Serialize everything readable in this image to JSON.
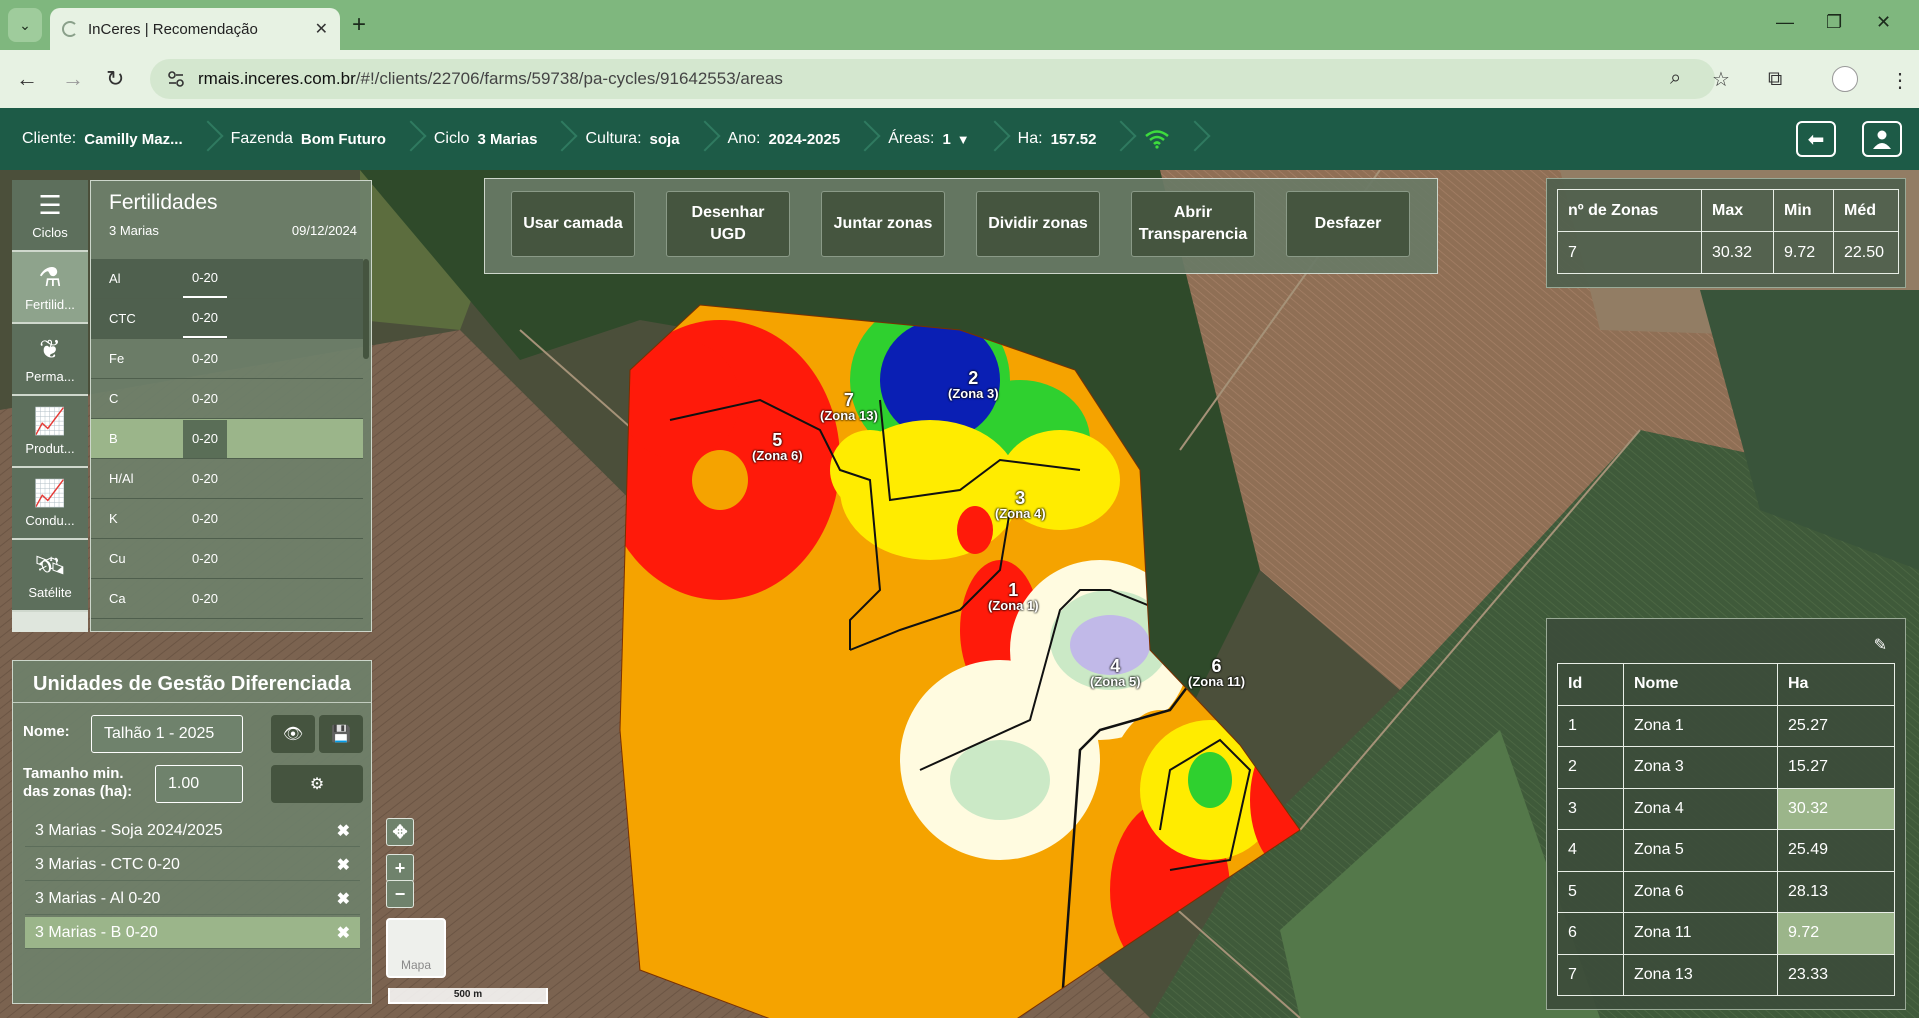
{
  "browser": {
    "tab_title": "InCeres | Recomendação",
    "url_host": "rmais.inceres.com.br",
    "url_path": "/#!/clients/22706/farms/59738/pa-cycles/91642553/areas"
  },
  "navbar": {
    "cliente_label": "Cliente:",
    "cliente_value": "Camilly Maz...",
    "fazenda_label": "Fazenda",
    "fazenda_value": "Bom Futuro",
    "ciclo_label": "Ciclo",
    "ciclo_value": "3 Marias",
    "cultura_label": "Cultura:",
    "cultura_value": "soja",
    "ano_label": "Ano:",
    "ano_value": "2024-2025",
    "areas_label": "Áreas:",
    "areas_value": "1",
    "ha_label": "Ha:",
    "ha_value": "157.52"
  },
  "rail": [
    {
      "label": "Ciclos",
      "icon": "list-icon"
    },
    {
      "label": "Fertilid...",
      "icon": "flask-icon"
    },
    {
      "label": "Perma...",
      "icon": "plant-icon"
    },
    {
      "label": "Produt...",
      "icon": "chart-icon"
    },
    {
      "label": "Condu...",
      "icon": "chart-icon"
    },
    {
      "label": "Satélite",
      "icon": "satellite-icon"
    }
  ],
  "fertilidades": {
    "title": "Fertilidades",
    "cycle": "3 Marias",
    "date": "09/12/2024",
    "rows": [
      {
        "name": "Al",
        "depth": "0-20"
      },
      {
        "name": "CTC",
        "depth": "0-20"
      },
      {
        "name": "Fe",
        "depth": "0-20"
      },
      {
        "name": "C",
        "depth": "0-20"
      },
      {
        "name": "B",
        "depth": "0-20"
      },
      {
        "name": "H/Al",
        "depth": "0-20"
      },
      {
        "name": "K",
        "depth": "0-20"
      },
      {
        "name": "Cu",
        "depth": "0-20"
      },
      {
        "name": "Ca",
        "depth": "0-20"
      }
    ]
  },
  "ugd": {
    "title": "Unidades de Gestão Diferenciada",
    "nome_label": "Nome:",
    "nome_value": "Talhão 1 - 2025",
    "tamanho_label_1": "Tamanho min.",
    "tamanho_label_2": "das zonas (ha):",
    "tamanho_value": "1.00",
    "layers": [
      "3 Marias - Soja 2024/2025",
      "3 Marias - CTC 0-20",
      "3 Marias - Al 0-20",
      "3 Marias - B 0-20"
    ]
  },
  "tools": {
    "usar_camada": "Usar camada",
    "desenhar_1": "Desenhar",
    "desenhar_2": "UGD",
    "juntar": "Juntar zonas",
    "dividir": "Dividir zonas",
    "abrir_1": "Abrir",
    "abrir_2": "Transparencia",
    "desfazer": "Desfazer"
  },
  "stats": {
    "headers": [
      "nº de Zonas",
      "Max",
      "Min",
      "Méd"
    ],
    "values": [
      "7",
      "30.32",
      "9.72",
      "22.50"
    ]
  },
  "zones": {
    "headers": [
      "Id",
      "Nome",
      "Ha"
    ],
    "rows": [
      {
        "id": "1",
        "name": "Zona 1",
        "ha": "25.27"
      },
      {
        "id": "2",
        "name": "Zona 3",
        "ha": "15.27"
      },
      {
        "id": "3",
        "name": "Zona 4",
        "ha": "30.32"
      },
      {
        "id": "4",
        "name": "Zona 5",
        "ha": "25.49"
      },
      {
        "id": "5",
        "name": "Zona 6",
        "ha": "28.13"
      },
      {
        "id": "6",
        "name": "Zona 11",
        "ha": "9.72"
      },
      {
        "id": "7",
        "name": "Zona 13",
        "ha": "23.33"
      }
    ]
  },
  "map": {
    "thumb_label": "Mapa",
    "scale_label": "500 m",
    "zone_labels": [
      {
        "num": "2",
        "name": "(Zona 3)"
      },
      {
        "num": "5",
        "name": "(Zona 6)"
      },
      {
        "num": "7",
        "name": "(Zona 13)"
      },
      {
        "num": "3",
        "name": "(Zona 4)"
      },
      {
        "num": "1",
        "name": "(Zona 1)"
      },
      {
        "num": "4",
        "name": "(Zona 5)"
      },
      {
        "num": "6",
        "name": "(Zona 11)"
      }
    ]
  },
  "colors": {
    "navbar": "#1d5b47",
    "panel": "#6e806b",
    "highlight": "#9bb58a",
    "chrome": "#7fb77e"
  }
}
